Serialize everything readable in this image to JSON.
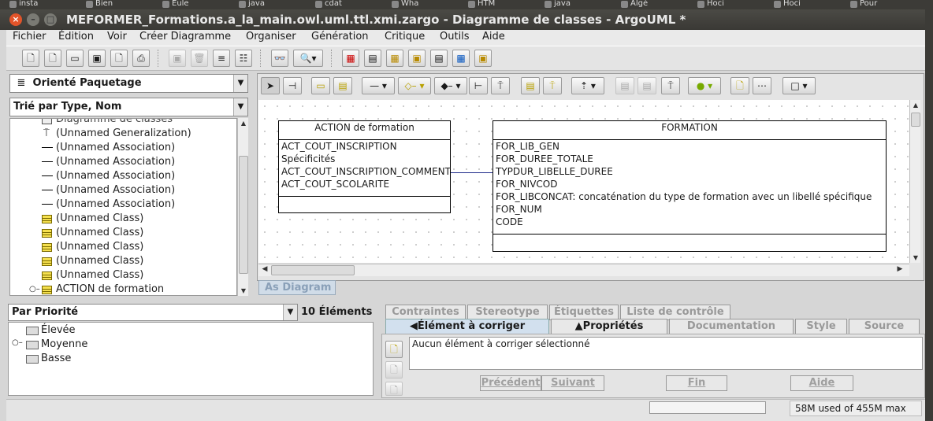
{
  "browser_tabs": [
    "insta",
    "Bien",
    "Eule",
    "java",
    "cdat",
    "Wha",
    "HTM",
    "java",
    "Algé",
    "Hoci",
    "Hoci",
    "Pour"
  ],
  "window": {
    "title": "MEFORMER_Formations.a_la_main.owl.uml.ttl.xmi.zargo - Diagramme de classes - ArgoUML *",
    "close": "×",
    "minimize": "–",
    "maximize": "□"
  },
  "menu": [
    "Fichier",
    "Édition",
    "Voir",
    "Créer Diagramme",
    "Organiser",
    "Génération",
    "Critique",
    "Outils",
    "Aide"
  ],
  "toolbar_icons": [
    "new-file-icon",
    "new-project-icon",
    "open-icon",
    "save-icon",
    "save-as-icon",
    "print-icon",
    "copy-icon",
    "delete-icon",
    "navigate-icon",
    "settings-icon",
    "find-icon",
    "zoom-icon",
    "class-diagram-icon",
    "usecase-diagram-icon",
    "state-diagram-icon",
    "activity-diagram-icon",
    "collaboration-diagram-icon",
    "deployment-diagram-icon",
    "sequence-diagram-icon"
  ],
  "explorer": {
    "perspective": "Orienté Paquetage",
    "order": "Trié par Type, Nom",
    "rows": [
      "Diagramme de classes",
      "(Unnamed Generalization)",
      "(Unnamed Association)",
      "(Unnamed Association)",
      "(Unnamed Association)",
      "(Unnamed Association)",
      "(Unnamed Association)",
      "(Unnamed Class)",
      "(Unnamed Class)",
      "(Unnamed Class)",
      "(Unnamed Class)",
      "(Unnamed Class)",
      "ACTION de formation"
    ]
  },
  "todo": {
    "order": "Par Priorité",
    "count": "10 Éléments",
    "items": [
      "Élevée",
      "Moyenne",
      "Basse"
    ]
  },
  "diagram": {
    "tab": "As Diagram",
    "classes": [
      {
        "name": "ACTION de formation",
        "attributes": [
          "ACT_COUT_INSCRIPTION",
          "Spécificités",
          "ACT_COUT_INSCRIPTION_COMMENT",
          "ACT_COUT_SCOLARITE"
        ]
      },
      {
        "name": "FORMATION",
        "attributes": [
          "FOR_LIB_GEN",
          "FOR_DUREE_TOTALE",
          "TYPDUR_LIBELLE_DUREE",
          "FOR_NIVCOD",
          "FOR_LIBCONCAT: concaténation du type de formation avec un libellé spécifique",
          "FOR_NUM",
          "CODE"
        ]
      }
    ]
  },
  "details": {
    "tabs_top": [
      "Contraintes",
      "Stereotype",
      "Étiquettes",
      "Liste de contrôle"
    ],
    "tabs_bottom": [
      "Élément à corriger",
      "Propriétés",
      "Documentation",
      "Style",
      "Source"
    ],
    "message": "Aucun élément à corriger sélectionné",
    "buttons": [
      "Précédent",
      "Suivant",
      "Fin",
      "Aide"
    ]
  },
  "status": {
    "memory": "58M used of 455M max"
  }
}
